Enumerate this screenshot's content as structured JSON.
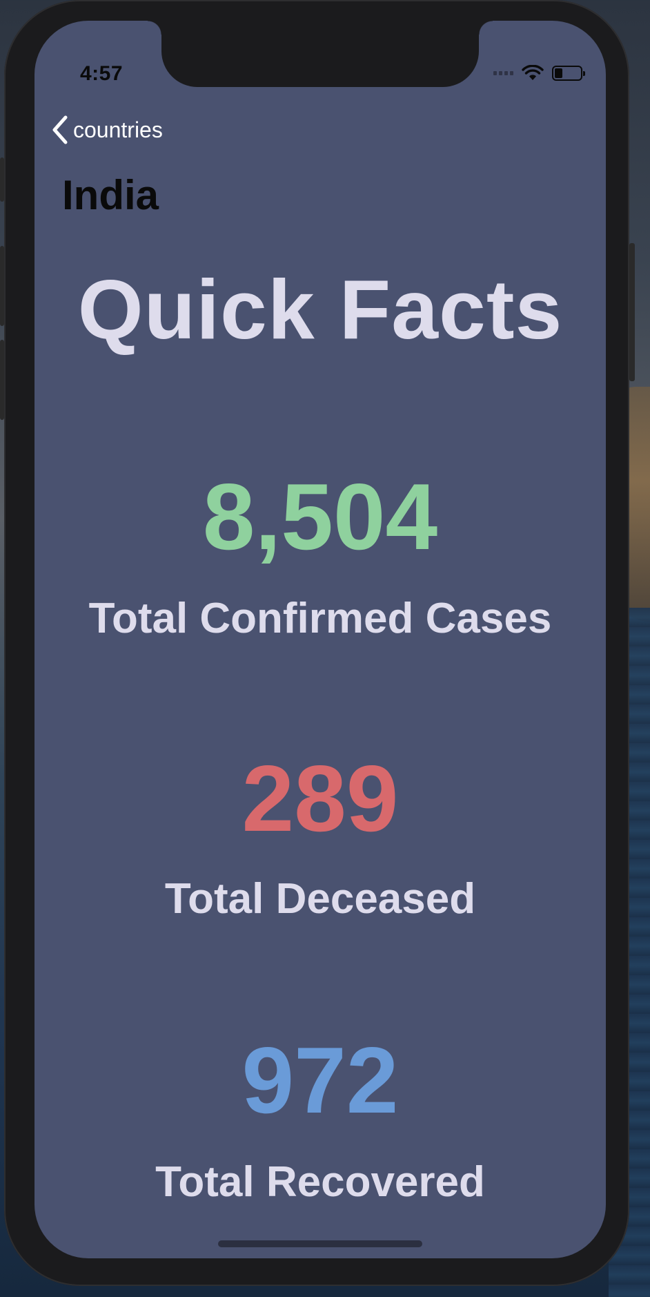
{
  "status_bar": {
    "time": "4:57",
    "battery_level": 0.3
  },
  "nav": {
    "back_label": "countries",
    "back_icon": "chevron-left-icon"
  },
  "header": {
    "country": "India"
  },
  "main": {
    "section_title": "Quick Facts",
    "stats": [
      {
        "value": "8,504",
        "label": "Total Confirmed Cases",
        "color": "#8fd19e"
      },
      {
        "value": "289",
        "label": "Total Deceased",
        "color": "#d8696c"
      },
      {
        "value": "972",
        "label": "Total Recovered",
        "color": "#6a9bd8"
      }
    ]
  },
  "colors": {
    "screen_background": "#4a5270",
    "label_text": "#dedcec"
  }
}
